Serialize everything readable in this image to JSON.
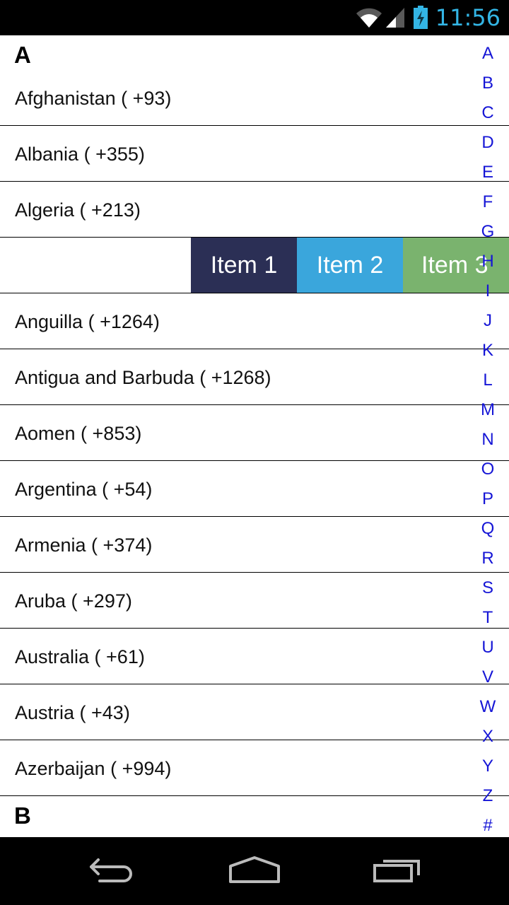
{
  "status_bar": {
    "time": "11:56",
    "icons": [
      "wifi-icon",
      "signal-icon",
      "battery-charging-icon"
    ],
    "accent_color": "#33b5e5"
  },
  "list": {
    "sections": [
      {
        "header": "A",
        "items": [
          "Afghanistan ( +93)",
          "Albania ( +355)",
          "Algeria ( +213)",
          "",
          "Anguilla ( +1264)",
          "Antigua and Barbuda ( +1268)",
          "Aomen ( +853)",
          "Argentina ( +54)",
          "Armenia ( +374)",
          "Aruba ( +297)",
          "Australia ( +61)",
          "Austria ( +43)",
          "Azerbaijan ( +994)"
        ]
      },
      {
        "header": "B",
        "items": []
      }
    ],
    "swipe_menu": {
      "row_index": 3,
      "buttons": [
        "Item 1",
        "Item 2",
        "Item 3"
      ],
      "colors": [
        "#2b2f55",
        "#3aa6dc",
        "#7ab36e"
      ]
    }
  },
  "index_bar": {
    "letters": [
      "A",
      "B",
      "C",
      "D",
      "E",
      "F",
      "G",
      "H",
      "I",
      "J",
      "K",
      "L",
      "M",
      "N",
      "O",
      "P",
      "Q",
      "R",
      "S",
      "T",
      "U",
      "V",
      "W",
      "X",
      "Y",
      "Z",
      "#"
    ],
    "color": "#1515d6"
  },
  "nav_bar": {
    "buttons": [
      "back-icon",
      "home-icon",
      "recent-apps-icon"
    ]
  }
}
